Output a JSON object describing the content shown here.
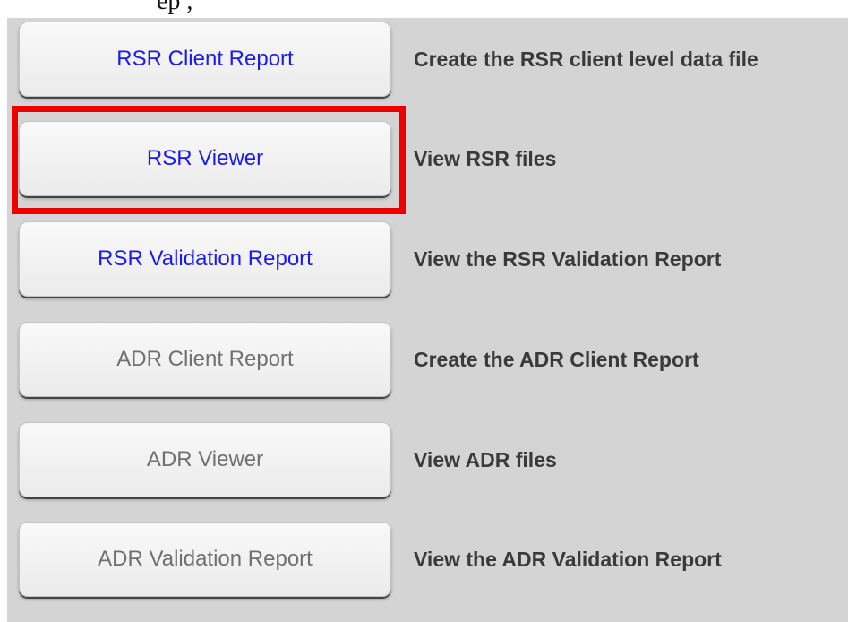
{
  "header": {
    "caption": "                         ep ,"
  },
  "reports": [
    {
      "button_label": "RSR Client Report",
      "description": "Create the RSR client level data file",
      "enabled": true
    },
    {
      "button_label": "RSR Viewer",
      "description": "View RSR files",
      "enabled": true,
      "highlighted": true
    },
    {
      "button_label": "RSR Validation Report",
      "description": "View the RSR Validation Report",
      "enabled": true
    },
    {
      "button_label": "ADR Client Report",
      "description": "Create the ADR Client Report",
      "enabled": false
    },
    {
      "button_label": "ADR Viewer",
      "description": "View ADR files",
      "enabled": false
    },
    {
      "button_label": "ADR Validation Report",
      "description": "View the ADR Validation Report",
      "enabled": false
    }
  ],
  "colors": {
    "panel_background": "#d4d4d4",
    "enabled_text": "#1a1aee",
    "disabled_text": "#707070",
    "description_text": "#3a3a3a",
    "highlight_border": "#ee0000"
  }
}
